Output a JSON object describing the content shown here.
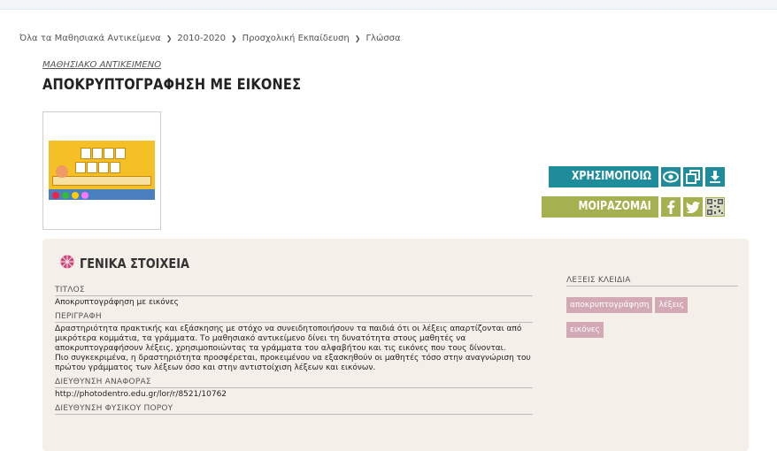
{
  "breadcrumb": [
    "Όλα τα Μαθησιακά Αντικείμενα",
    "2010-2020",
    "Προσχολική Εκπαίδευση",
    "Γλώσσα"
  ],
  "breadcrumb_separator": "❯",
  "object": {
    "kicker": "ΜΑΘΗΣΙΑΚΟ ΑΝΤΙΚΕΙΜΕΝΟ",
    "title": "ΑΠΟΚΡΥΠΤΟΓΡΑΦΗΣΗ ΜΕ ΕΙΚΟΝΕΣ"
  },
  "actions": {
    "use_label": "ΧΡΗΣΙΜΟΠΟΙΩ",
    "share_label": "ΜΟΙΡΑΖΟΜΑΙ",
    "use_icons": [
      "eye-icon",
      "copy-icon",
      "download-icon"
    ],
    "share_icons": [
      "facebook-icon",
      "twitter-icon",
      "qr-code-icon"
    ],
    "colors": {
      "use": "#1f8c9c",
      "share": "#a5b04f",
      "tag": "#d3a9b6",
      "section_icon": "#d0457e"
    }
  },
  "general": {
    "heading": "ΓΕΝΙΚΑ ΣΤΟΙΧΕΙΑ",
    "title_label": "ΤΙΤΛΟΣ",
    "title_value": "Αποκρυπτογράφηση με εικόνες",
    "description_label": "ΠΕΡΙΓΡΑΦΗ",
    "description_p1": "Δραστηριότητα πρακτικής και εξάσκησης με στόχο να συνειδητοποιήσουν τα παιδιά ότι οι λέξεις απαρτίζονται από μικρότερα κομμάτια, τα γράμματα. Το μαθησιακό αντικείμενο δίνει τη δυνατότητα στους μαθητές να αποκρυπτογραφήσουν λέξεις, χρησιμοποιώντας τα γράμματα του αλφαβήτου και τις εικόνες που τους δίνονται.",
    "description_p2": "Πιο συγκεκριμένα, η δραστηριότητα προσφέρεται, προκειμένου να εξασκηθούν οι μαθητές τόσο στην αναγνώριση του πρώτου γράμματος των λέξεων όσο και στην αντιστοίχιση λέξεων και εικόνων.",
    "reference_label": "ΔΙΕΥΘΥΝΣΗ ΑΝΑΦΟΡΑΣ",
    "reference_value": "http://photodentro.edu.gr/lor/r/8521/10762",
    "physical_label": "ΔΙΕΥΘΥΝΣΗ ΦΥΣΙΚΟΥ ΠΟΡΟΥ"
  },
  "keywords": {
    "heading": "ΛΕΞΕΙΣ ΚΛΕΙΔΙΑ",
    "items": [
      "αποκρυπτογράφηση",
      "λέξεις",
      "εικόνες"
    ]
  }
}
